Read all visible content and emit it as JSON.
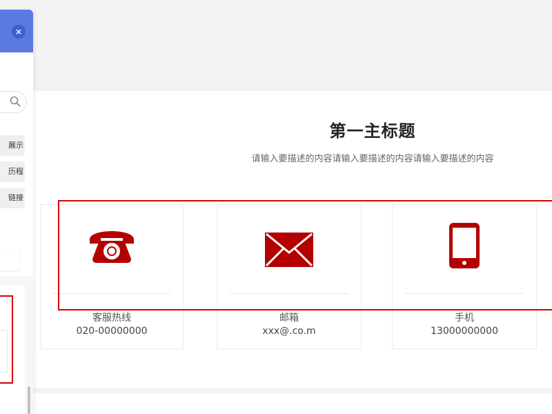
{
  "colors": {
    "accent": "#b30000",
    "panel_header": "#5b79e0",
    "selection": "#d40000"
  },
  "panel": {
    "close_label": "×",
    "chips": [
      "展示",
      "历程",
      "链接"
    ]
  },
  "main": {
    "title": "第一主标题",
    "description": "请输入要描述的内容请输入要描述的内容请输入要描述的内容",
    "cards": [
      {
        "icon": "telephone-icon",
        "label": "客服热线",
        "value": "020-00000000"
      },
      {
        "icon": "envelope-icon",
        "label": "邮箱",
        "value": "xxx@.co.m"
      },
      {
        "icon": "mobile-phone-icon",
        "label": "手机",
        "value": "13000000000"
      }
    ]
  }
}
